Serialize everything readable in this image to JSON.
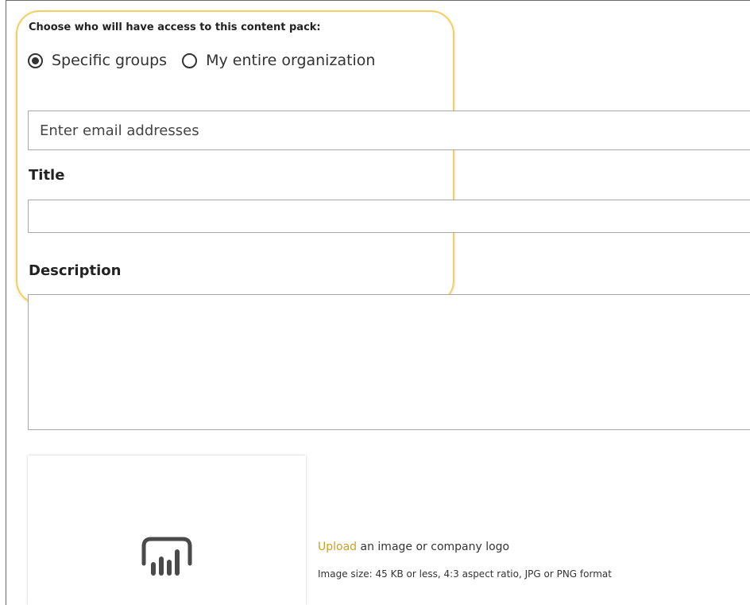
{
  "access": {
    "label": "Choose who will have access to this content pack:",
    "options": [
      {
        "label": "Specific groups",
        "selected": true
      },
      {
        "label": "My entire organization",
        "selected": false
      }
    ]
  },
  "email": {
    "placeholder": "Enter email addresses",
    "value": ""
  },
  "title_field": {
    "label": "Title",
    "value": ""
  },
  "description_field": {
    "label": "Description",
    "value": ""
  },
  "logo": {
    "icon": "power-bi-chart-icon",
    "upload_link": "Upload",
    "upload_text": " an image or company logo",
    "size_note": "Image size: 45 KB or less, 4:3 aspect ratio, JPG or PNG format"
  },
  "colors": {
    "highlight": "#f4cf63",
    "link": "#c9a227",
    "text": "#333333",
    "border": "#a7a7a7"
  }
}
